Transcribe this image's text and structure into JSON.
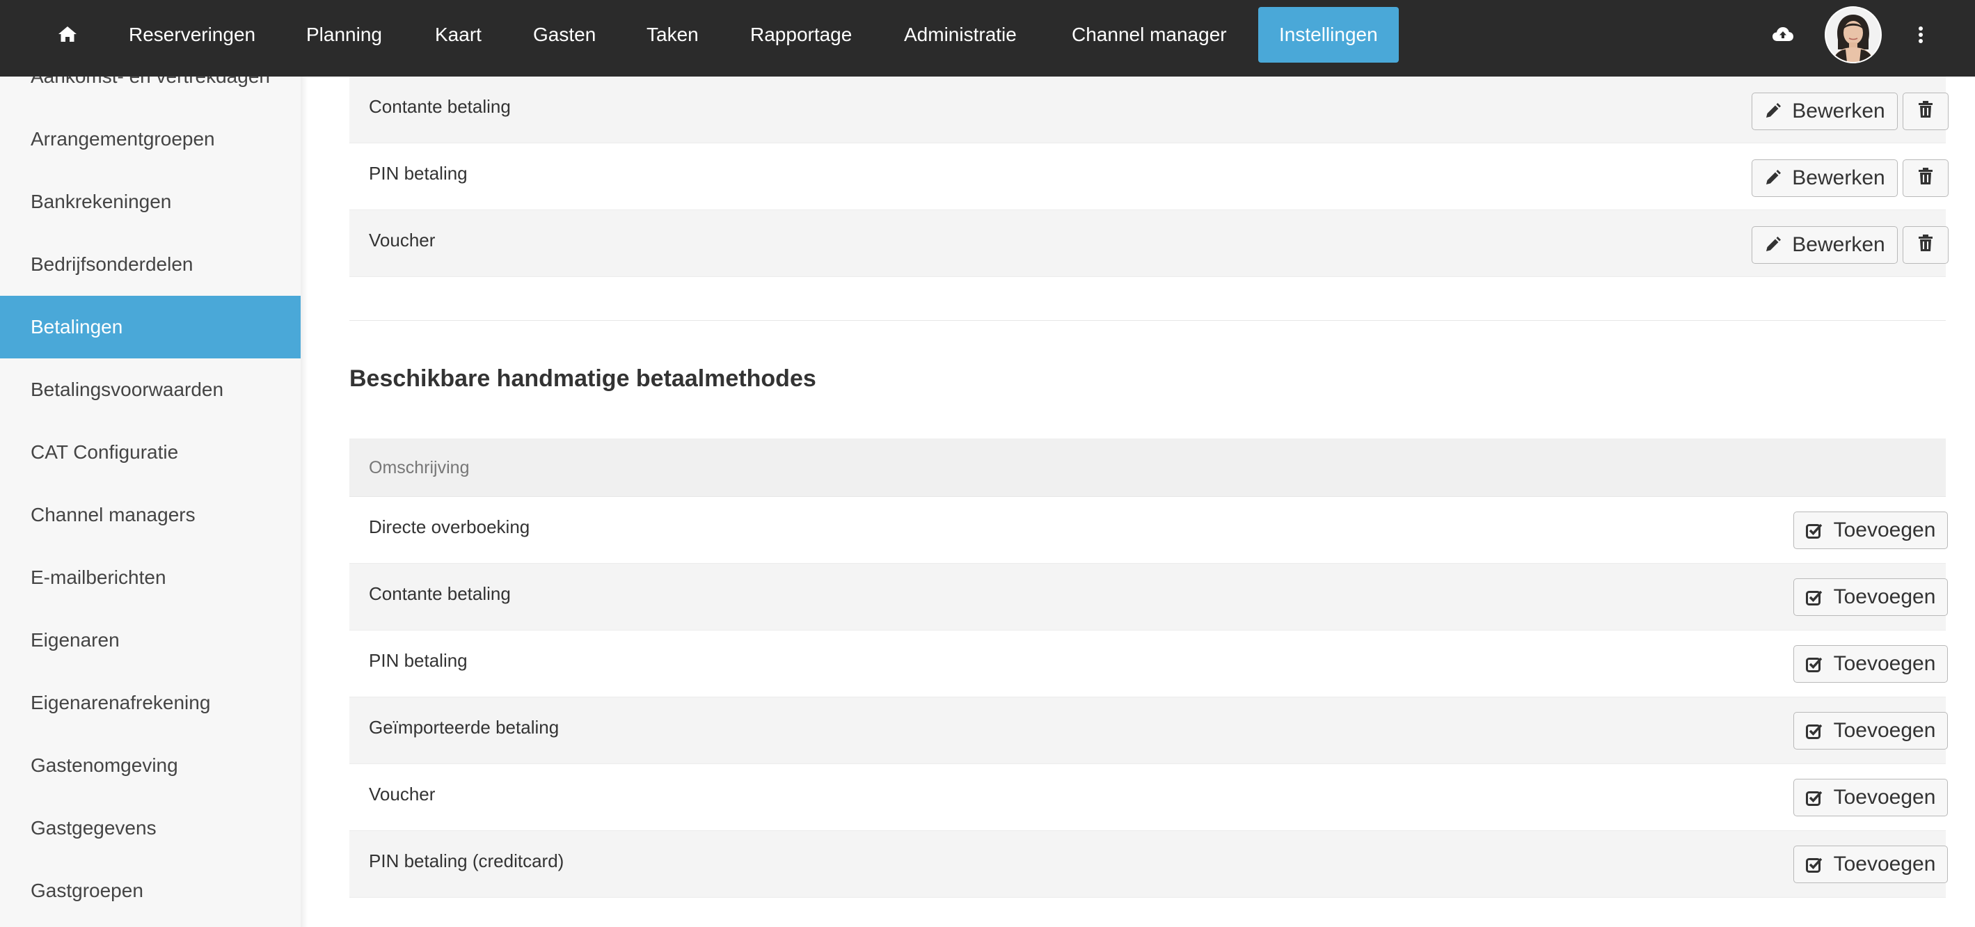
{
  "nav": {
    "home_icon": "home-icon",
    "items": [
      "Reserveringen",
      "Planning",
      "Kaart",
      "Gasten",
      "Taken",
      "Rapportage",
      "Administratie",
      "Channel manager",
      "Instellingen"
    ],
    "active_item": "Instellingen",
    "upload_icon": "cloud-upload-icon",
    "avatar_icon": "avatar",
    "more_icon": "more-vertical-icon"
  },
  "sidebar": {
    "items": [
      "Aankomst- en vertrekdagen",
      "Arrangementgroepen",
      "Bankrekeningen",
      "Bedrijfsonderdelen",
      "Betalingen",
      "Betalingsvoorwaarden",
      "CAT Configuratie",
      "Channel managers",
      "E-mailberichten",
      "Eigenaren",
      "Eigenarenafrekening",
      "Gastenomgeving",
      "Gastgegevens",
      "Gastgroepen"
    ],
    "active_item": "Betalingen"
  },
  "configured_methods": {
    "rows": [
      {
        "label": "Contante betaling",
        "edit_label": "Bewerken"
      },
      {
        "label": "PIN betaling",
        "edit_label": "Bewerken"
      },
      {
        "label": "Voucher",
        "edit_label": "Bewerken"
      }
    ],
    "edit_icon": "pencil-icon",
    "delete_icon": "trash-icon"
  },
  "available_methods": {
    "title": "Beschikbare handmatige betaalmethodes",
    "column_header": "Omschrijving",
    "add_icon": "check-square-icon",
    "rows": [
      {
        "label": "Directe overboeking",
        "add_label": "Toevoegen"
      },
      {
        "label": "Contante betaling",
        "add_label": "Toevoegen"
      },
      {
        "label": "PIN betaling",
        "add_label": "Toevoegen"
      },
      {
        "label": "Geïmporteerde betaling",
        "add_label": "Toevoegen"
      },
      {
        "label": "Voucher",
        "add_label": "Toevoegen"
      },
      {
        "label": "PIN betaling (creditcard)",
        "add_label": "Toevoegen"
      }
    ]
  },
  "colors": {
    "topbar": "#2b2b2b",
    "accent": "#4aa8d8",
    "sidebar_bg": "#f7f7f7",
    "row_shade": "#f4f4f4"
  }
}
